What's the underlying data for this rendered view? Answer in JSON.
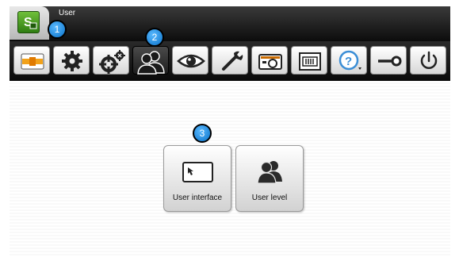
{
  "window": {
    "title": "User"
  },
  "toolbar": {
    "buttons": [
      {
        "icon": "machine-icon"
      },
      {
        "icon": "gear-icon"
      },
      {
        "icon": "gears-icon"
      },
      {
        "icon": "users-icon",
        "active": true
      },
      {
        "icon": "eye-icon"
      },
      {
        "icon": "wrench-icon"
      },
      {
        "icon": "camera-icon"
      },
      {
        "icon": "panel-icon"
      },
      {
        "icon": "help-icon"
      },
      {
        "icon": "key-icon"
      },
      {
        "icon": "power-icon"
      }
    ]
  },
  "content": {
    "buttons": [
      {
        "label": "User interface",
        "icon": "cursor-window-icon"
      },
      {
        "label": "User level",
        "icon": "users-icon"
      }
    ]
  },
  "callouts": [
    "1",
    "2",
    "3"
  ],
  "colors": {
    "accent": "#0a72c9",
    "app_green": "#4c9a22",
    "bar": "#111111"
  }
}
